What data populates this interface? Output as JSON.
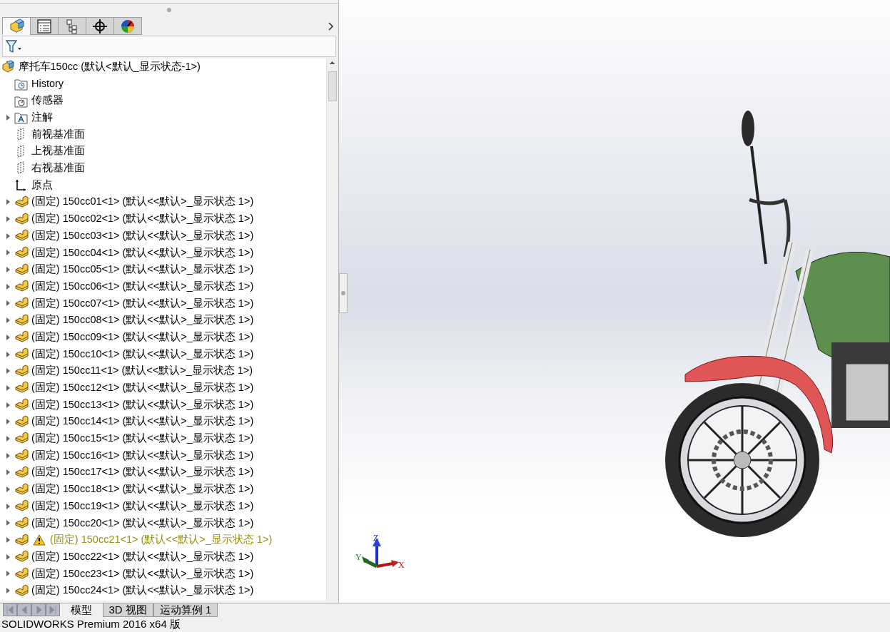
{
  "panel_tabs": [
    {
      "kind": "feature-tree",
      "selected": true
    },
    {
      "kind": "property",
      "selected": false
    },
    {
      "kind": "config",
      "selected": false
    },
    {
      "kind": "dimxpert",
      "selected": false
    },
    {
      "kind": "display",
      "selected": false
    }
  ],
  "tree": {
    "label": "摩托车150cc  (默认<默认_显示状态-1>)",
    "expanded": true,
    "children": [
      {
        "kind": "history",
        "label": "History",
        "warning": false
      },
      {
        "kind": "sensor",
        "label": "传感器",
        "warning": false
      },
      {
        "kind": "annotation",
        "label": "注解",
        "expanded": false,
        "warning": false
      },
      {
        "kind": "plane",
        "label": "前视基准面",
        "warning": false
      },
      {
        "kind": "plane",
        "label": "上视基准面",
        "warning": false
      },
      {
        "kind": "plane",
        "label": "右视基准面",
        "warning": false
      },
      {
        "kind": "origin",
        "label": "原点",
        "warning": false
      },
      {
        "kind": "part",
        "label": "(固定) 150cc01<1> (默认<<默认>_显示状态 1>)",
        "expanded": false,
        "warning": false
      },
      {
        "kind": "part",
        "label": "(固定) 150cc02<1> (默认<<默认>_显示状态 1>)",
        "expanded": false,
        "warning": false
      },
      {
        "kind": "part",
        "label": "(固定) 150cc03<1> (默认<<默认>_显示状态 1>)",
        "expanded": false,
        "warning": false
      },
      {
        "kind": "part",
        "label": "(固定) 150cc04<1> (默认<<默认>_显示状态 1>)",
        "expanded": false,
        "warning": false
      },
      {
        "kind": "part",
        "label": "(固定) 150cc05<1> (默认<<默认>_显示状态 1>)",
        "expanded": false,
        "warning": false
      },
      {
        "kind": "part",
        "label": "(固定) 150cc06<1> (默认<<默认>_显示状态 1>)",
        "expanded": false,
        "warning": false
      },
      {
        "kind": "part",
        "label": "(固定) 150cc07<1> (默认<<默认>_显示状态 1>)",
        "expanded": false,
        "warning": false
      },
      {
        "kind": "part",
        "label": "(固定) 150cc08<1> (默认<<默认>_显示状态 1>)",
        "expanded": false,
        "warning": false
      },
      {
        "kind": "part",
        "label": "(固定) 150cc09<1> (默认<<默认>_显示状态 1>)",
        "expanded": false,
        "warning": false
      },
      {
        "kind": "part",
        "label": "(固定) 150cc10<1> (默认<<默认>_显示状态 1>)",
        "expanded": false,
        "warning": false
      },
      {
        "kind": "part",
        "label": "(固定) 150cc11<1> (默认<<默认>_显示状态 1>)",
        "expanded": false,
        "warning": false
      },
      {
        "kind": "part",
        "label": "(固定) 150cc12<1> (默认<<默认>_显示状态 1>)",
        "expanded": false,
        "warning": false
      },
      {
        "kind": "part",
        "label": "(固定) 150cc13<1> (默认<<默认>_显示状态 1>)",
        "expanded": false,
        "warning": false
      },
      {
        "kind": "part",
        "label": "(固定) 150cc14<1> (默认<<默认>_显示状态 1>)",
        "expanded": false,
        "warning": false
      },
      {
        "kind": "part",
        "label": "(固定) 150cc15<1> (默认<<默认>_显示状态 1>)",
        "expanded": false,
        "warning": false
      },
      {
        "kind": "part",
        "label": "(固定) 150cc16<1> (默认<<默认>_显示状态 1>)",
        "expanded": false,
        "warning": false
      },
      {
        "kind": "part",
        "label": "(固定) 150cc17<1> (默认<<默认>_显示状态 1>)",
        "expanded": false,
        "warning": false
      },
      {
        "kind": "part",
        "label": "(固定) 150cc18<1> (默认<<默认>_显示状态 1>)",
        "expanded": false,
        "warning": false
      },
      {
        "kind": "part",
        "label": "(固定) 150cc19<1> (默认<<默认>_显示状态 1>)",
        "expanded": false,
        "warning": false
      },
      {
        "kind": "part",
        "label": "(固定) 150cc20<1> (默认<<默认>_显示状态 1>)",
        "expanded": false,
        "warning": false
      },
      {
        "kind": "part",
        "label": "(固定) 150cc21<1> (默认<<默认>_显示状态 1>)",
        "expanded": false,
        "warning": true
      },
      {
        "kind": "part",
        "label": "(固定) 150cc22<1> (默认<<默认>_显示状态 1>)",
        "expanded": false,
        "warning": false
      },
      {
        "kind": "part",
        "label": "(固定) 150cc23<1> (默认<<默认>_显示状态 1>)",
        "expanded": false,
        "warning": false
      },
      {
        "kind": "part",
        "label": "(固定) 150cc24<1> (默认<<默认>_显示状态 1>)",
        "expanded": false,
        "warning": false
      }
    ]
  },
  "triad": {
    "x": "X",
    "y": "Y",
    "z": "Z"
  },
  "bottom_tabs": [
    {
      "label": "模型",
      "selected": true
    },
    {
      "label": "3D 视图",
      "selected": false
    },
    {
      "label": "运动算例 1",
      "selected": false
    }
  ],
  "status_bar": "SOLIDWORKS Premium 2016 x64 版"
}
